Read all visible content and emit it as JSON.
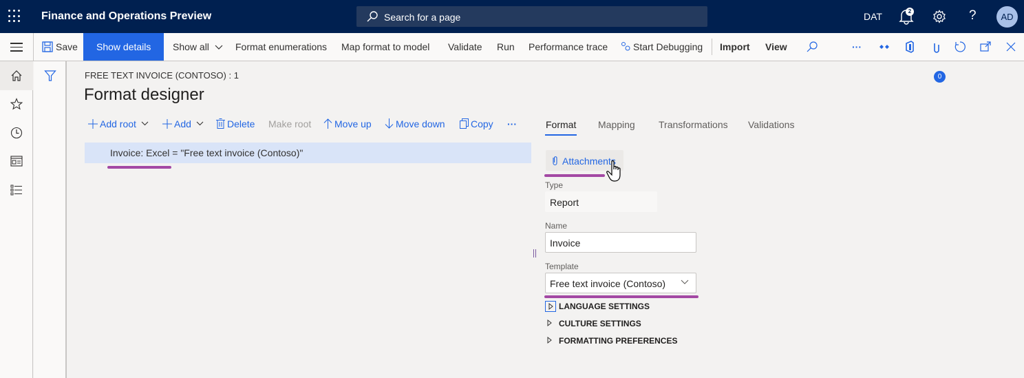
{
  "app": {
    "title": "Finance and Operations Preview",
    "search_placeholder": "Search for a page",
    "company": "DAT",
    "notification_count": "2",
    "help_label": "?",
    "user_initials": "AD"
  },
  "actionbar": {
    "save": "Save",
    "show_details": "Show details",
    "show_all": "Show all",
    "format_enumerations": "Format enumerations",
    "map_format_to_model": "Map format to model",
    "validate": "Validate",
    "run": "Run",
    "performance_trace": "Performance trace",
    "start_debugging": "Start Debugging",
    "import": "Import",
    "view": "View",
    "more": "···",
    "attachments_count": "0"
  },
  "page": {
    "breadcrumb": "FREE TEXT INVOICE (CONTOSO) : 1",
    "title": "Format designer"
  },
  "tree_toolbar": {
    "add_root": "Add root",
    "add": "Add",
    "delete": "Delete",
    "make_root": "Make root",
    "move_up": "Move up",
    "move_down": "Move down",
    "copy": "Copy",
    "more": "···"
  },
  "tree": {
    "items": [
      {
        "label": "Invoice: Excel = \"Free text invoice (Contoso)\"",
        "selected": true
      }
    ]
  },
  "tabs": [
    {
      "label": "Format",
      "active": true
    },
    {
      "label": "Mapping",
      "active": false
    },
    {
      "label": "Transformations",
      "active": false
    },
    {
      "label": "Validations",
      "active": false
    }
  ],
  "details": {
    "attachments_label": "Attachments",
    "type_label": "Type",
    "type_value": "Report",
    "name_label": "Name",
    "name_value": "Invoice",
    "template_label": "Template",
    "template_value": "Free text invoice (Contoso)",
    "sections": [
      {
        "label": "LANGUAGE SETTINGS"
      },
      {
        "label": "CULTURE SETTINGS"
      },
      {
        "label": "FORMATTING PREFERENCES"
      }
    ]
  },
  "colors": {
    "nav_bg": "#002050",
    "accent": "#2266e3",
    "selected_row": "#d9e4f8",
    "highlight_underline": "#a349a4"
  }
}
